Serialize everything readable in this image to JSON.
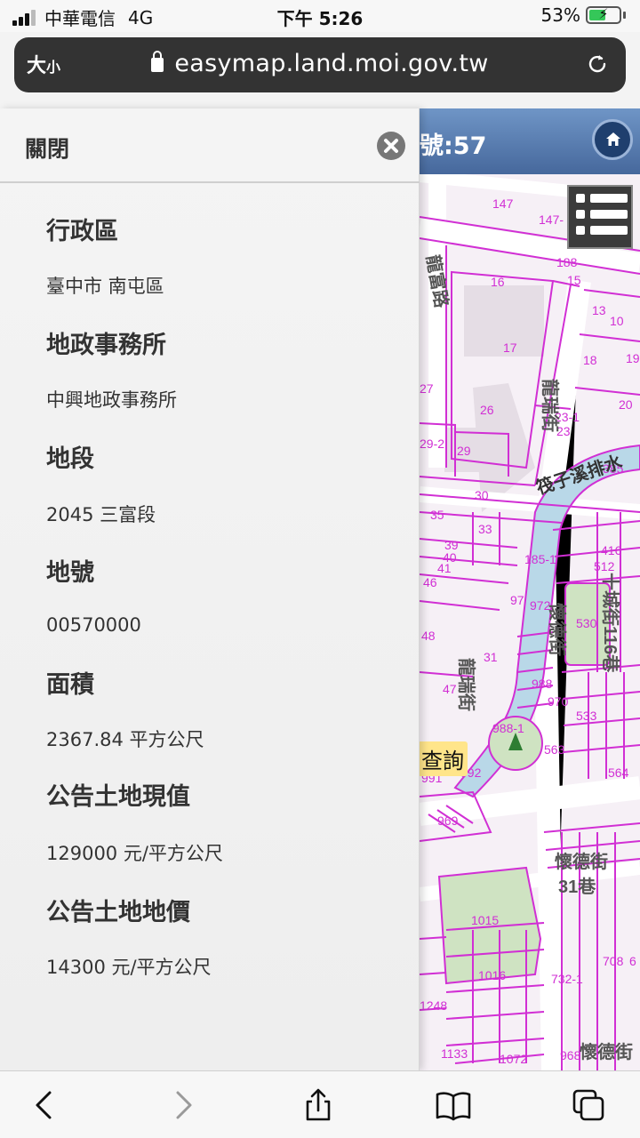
{
  "status_bar": {
    "carrier": "中華電信",
    "network": "4G",
    "time": "下午 5:26",
    "battery": "53%",
    "battery_color": "#35c759"
  },
  "url_bar": {
    "text_size_big": "大",
    "text_size_small": "小",
    "domain": "easymap.land.moi.gov.tw",
    "icons": [
      "lock-icon",
      "reload-icon"
    ]
  },
  "drawer": {
    "close_label": "關閉",
    "fields": [
      {
        "label": "行政區",
        "value": "臺中市 南屯區"
      },
      {
        "label": "地政事務所",
        "value": "中興地政事務所"
      },
      {
        "label": "地段",
        "value": "2045 三富段"
      },
      {
        "label": "地號",
        "value": "00570000"
      },
      {
        "label": "面積",
        "value": "2367.84 平方公尺"
      },
      {
        "label": "公告土地現值",
        "value": "129000 元/平方公尺"
      },
      {
        "label": "公告土地地價",
        "value": "14300 元/平方公尺"
      }
    ]
  },
  "map": {
    "header_text": "號:57",
    "query_label": "查詢",
    "parcel_labels": [
      "147",
      "147-",
      "188",
      "15",
      "16",
      "13",
      "10",
      "17",
      "18",
      "19",
      "27",
      "26",
      "20",
      "23-1",
      "23",
      "29-2",
      "29",
      "385",
      "30",
      "35",
      "33",
      "39",
      "40",
      "41",
      "185-1",
      "416",
      "512",
      "46",
      "97",
      "972",
      "530",
      "48",
      "31",
      "988",
      "47",
      "970",
      "533",
      "988-1",
      "563",
      "992",
      "991",
      "564",
      "969",
      "1015",
      "1016",
      "708",
      "6",
      "732-1",
      "1248",
      "1133",
      "1072",
      "968"
    ],
    "street_labels": [
      "龍富路",
      "龍瑞街",
      "筏子溪排水",
      "懷德街",
      "龍瑞街",
      "懷德街",
      "十城街116巷",
      "懷德街31巷",
      "懷德街"
    ],
    "colors": {
      "parcel_line": "#d12fd4",
      "water": "#b9d8e8",
      "park": "#cfe3c2",
      "road": "#ffffff",
      "header": "#46689c"
    }
  },
  "toolbar": {
    "icons": [
      "back-icon",
      "forward-icon",
      "share-icon",
      "bookmarks-icon",
      "tabs-icon"
    ]
  }
}
